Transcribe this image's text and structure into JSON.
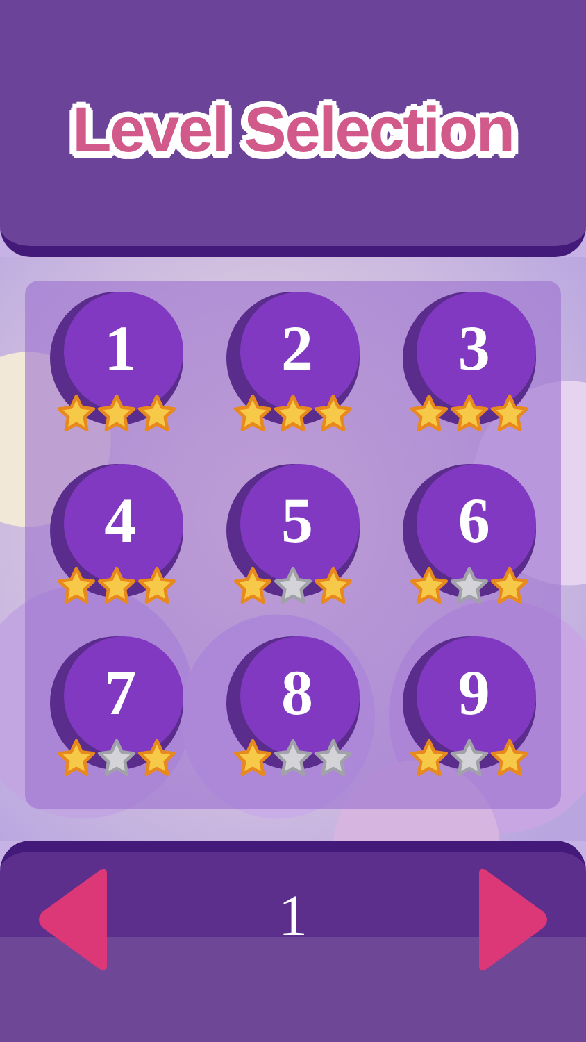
{
  "title": "Level Selection",
  "levels": [
    {
      "number": "1",
      "stars": 3
    },
    {
      "number": "2",
      "stars": 3
    },
    {
      "number": "3",
      "stars": 3
    },
    {
      "number": "4",
      "stars": 3
    },
    {
      "number": "5",
      "stars": 2
    },
    {
      "number": "6",
      "stars": 2
    },
    {
      "number": "7",
      "stars": 2
    },
    {
      "number": "8",
      "stars": 1
    },
    {
      "number": "9",
      "stars": 2
    }
  ],
  "page": "1"
}
